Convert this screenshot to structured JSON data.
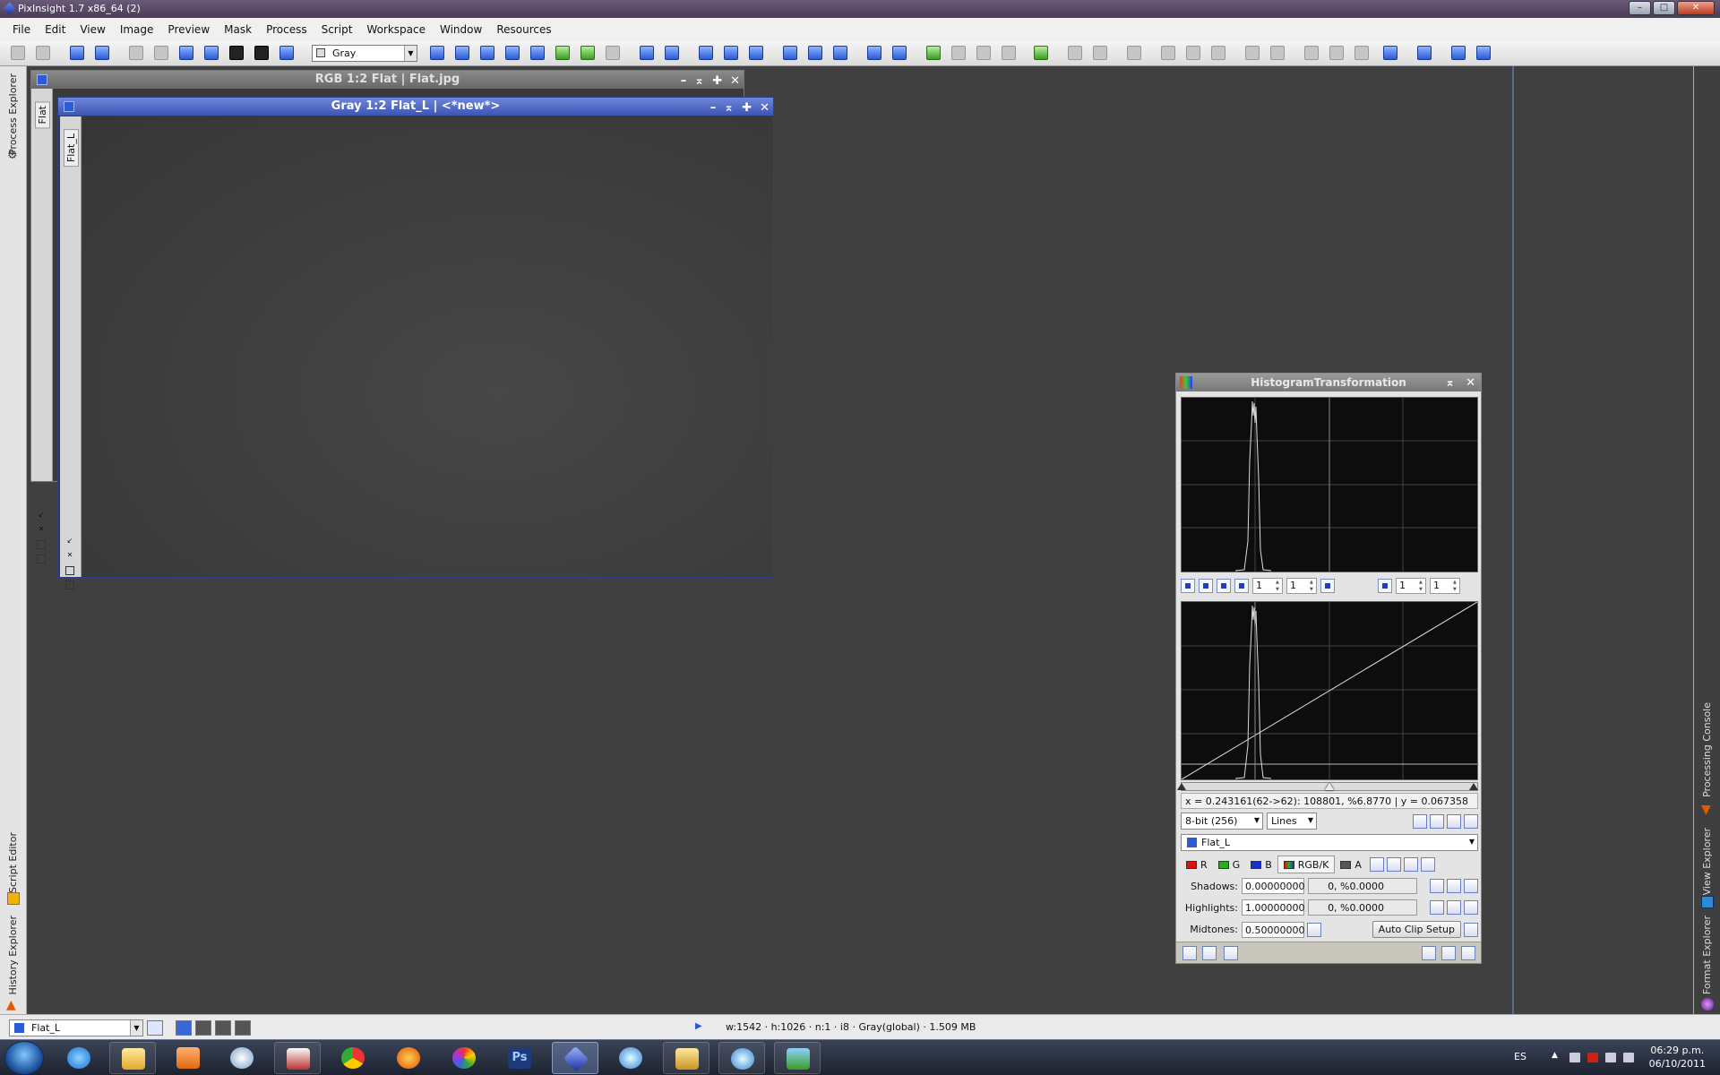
{
  "window": {
    "title": "PixInsight 1.7 x86_64 (2)",
    "controls": [
      "–",
      "□",
      "✕"
    ]
  },
  "menu": [
    "File",
    "Edit",
    "View",
    "Image",
    "Preview",
    "Mask",
    "Process",
    "Script",
    "Workspace",
    "Window",
    "Resources"
  ],
  "toolbar": {
    "color_space_select": "Gray"
  },
  "left_sidebar": {
    "tabs": [
      "Process Explorer",
      "Script Editor",
      "History Explorer"
    ]
  },
  "right_sidebar": {
    "tabs": [
      "Processing Console",
      "View Explorer",
      "Format Explorer"
    ]
  },
  "image_windows": [
    {
      "title": "RGB 1:2 Flat | Flat.jpg",
      "tab": "Flat"
    },
    {
      "title": "Gray 1:2 Flat_L | <*new*>",
      "tab": "Flat_L"
    }
  ],
  "histogram_panel": {
    "title": "HistogramTransformation",
    "zoom": {
      "h1": "1",
      "v1": "1",
      "h2": "1",
      "v2": "1"
    },
    "readout": "x = 0.243161(62->62): 108801, %6.8770 | y = 0.067358",
    "resolution": "8-bit (256)",
    "graph_style": "Lines",
    "view": "Flat_L",
    "channels": [
      {
        "label": "R",
        "color": "#e01010"
      },
      {
        "label": "G",
        "color": "#20b020"
      },
      {
        "label": "B",
        "color": "#1a2fd0"
      },
      {
        "label": "RGB/K",
        "color": "#303030"
      },
      {
        "label": "A",
        "color": "#555555"
      }
    ],
    "shadows_label": "Shadows:",
    "shadows_value": "0.00000000",
    "shadows_clip": "0, %0.0000",
    "highlights_label": "Highlights:",
    "highlights_value": "1.00000000",
    "highlights_clip": "0, %0.0000",
    "midtones_label": "Midtones:",
    "midtones_value": "0.50000000",
    "auto_clip_label": "Auto Clip Setup",
    "midtones_balance": 0.5
  },
  "statusbar": {
    "view": "Flat_L",
    "info": "w:1542 · h:1026 · n:1 · i8 · Gray(global) · 1.509 MB"
  },
  "taskbar": {
    "apps": [
      "internet-explorer",
      "file-explorer",
      "media-player",
      "settings",
      "stellarium",
      "chrome",
      "firefox",
      "picasa",
      "photoshop",
      "pixinsight",
      "safari",
      "folder",
      "safari-2",
      "image-viewer"
    ],
    "lang": "ES",
    "time": "06:29 p.m.",
    "date": "06/10/2011"
  }
}
